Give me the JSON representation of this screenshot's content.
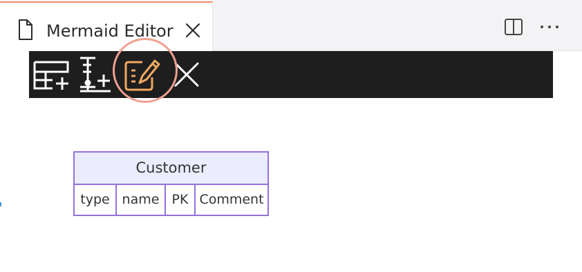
{
  "tab": {
    "title": "Mermaid Editor",
    "icon": "file-icon",
    "accent_color": "#f28f6a"
  },
  "editor_actions": {
    "split_icon": "split-editor-icon",
    "more_icon": "more-actions-icon"
  },
  "toolbar": {
    "background": "#1e1e1e",
    "buttons": [
      {
        "icon": "add-table-icon"
      },
      {
        "icon": "add-column-icon"
      },
      {
        "icon": "edit-icon",
        "highlighted": true,
        "color": "#f0a860"
      },
      {
        "icon": "close-icon"
      }
    ]
  },
  "entity": {
    "name": "Customer",
    "border_color": "#9370db",
    "header_color": "#ececff",
    "attributes": [
      "type",
      "name",
      "PK",
      "Comment"
    ]
  }
}
